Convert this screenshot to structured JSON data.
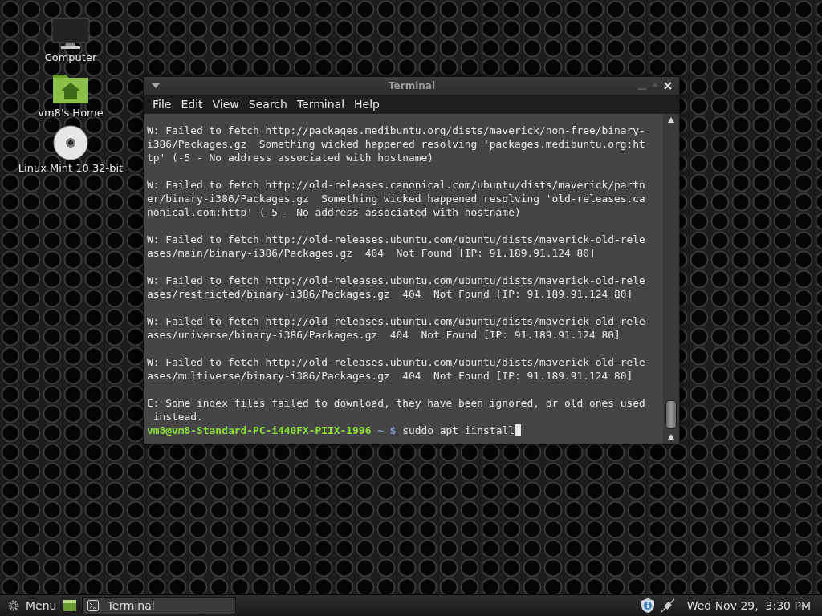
{
  "desktop_icons": [
    {
      "kind": "computer",
      "label": "Computer"
    },
    {
      "kind": "home",
      "label": "vm8's Home"
    },
    {
      "kind": "disc",
      "label": "Linux Mint 10 32-bit"
    }
  ],
  "window": {
    "title": "Terminal",
    "menu": [
      "File",
      "Edit",
      "View",
      "Search",
      "Terminal",
      "Help"
    ],
    "output": [
      [
        "W: Failed to fetch http://packages.medibuntu.org/dists/maverick/non-free/binary-",
        "i386/Packages.gz  Something wicked happened resolving 'packages.medibuntu.org:ht",
        "tp' (-5 - No address associated with hostname)"
      ],
      [
        "W: Failed to fetch http://old-releases.canonical.com/ubuntu/dists/maverick/partn",
        "er/binary-i386/Packages.gz  Something wicked happened resolving 'old-releases.ca",
        "nonical.com:http' (-5 - No address associated with hostname)"
      ],
      [
        "W: Failed to fetch http://old-releases.ubuntu.com/ubuntu/dists/maverick-old-rele",
        "ases/main/binary-i386/Packages.gz  404  Not Found [IP: 91.189.91.124 80]"
      ],
      [
        "W: Failed to fetch http://old-releases.ubuntu.com/ubuntu/dists/maverick-old-rele",
        "ases/restricted/binary-i386/Packages.gz  404  Not Found [IP: 91.189.91.124 80]"
      ],
      [
        "W: Failed to fetch http://old-releases.ubuntu.com/ubuntu/dists/maverick-old-rele",
        "ases/universe/binary-i386/Packages.gz  404  Not Found [IP: 91.189.91.124 80]"
      ],
      [
        "W: Failed to fetch http://old-releases.ubuntu.com/ubuntu/dists/maverick-old-rele",
        "ases/multiverse/binary-i386/Packages.gz  404  Not Found [IP: 91.189.91.124 80]"
      ],
      [
        "E: Some index files failed to download, they have been ignored, or old ones used",
        " instead."
      ]
    ],
    "prompt": {
      "user_host": "vm8@vm8-Standard-PC-i440FX-PIIX-1996",
      "path": "~",
      "symbol": "$",
      "command": "suddo apt iinstall"
    }
  },
  "taskbar": {
    "menu_label": "Menu",
    "tasks": [
      {
        "label": "Terminal",
        "selected": true
      }
    ],
    "clock": "Wed Nov 29,  3:30 PM"
  }
}
